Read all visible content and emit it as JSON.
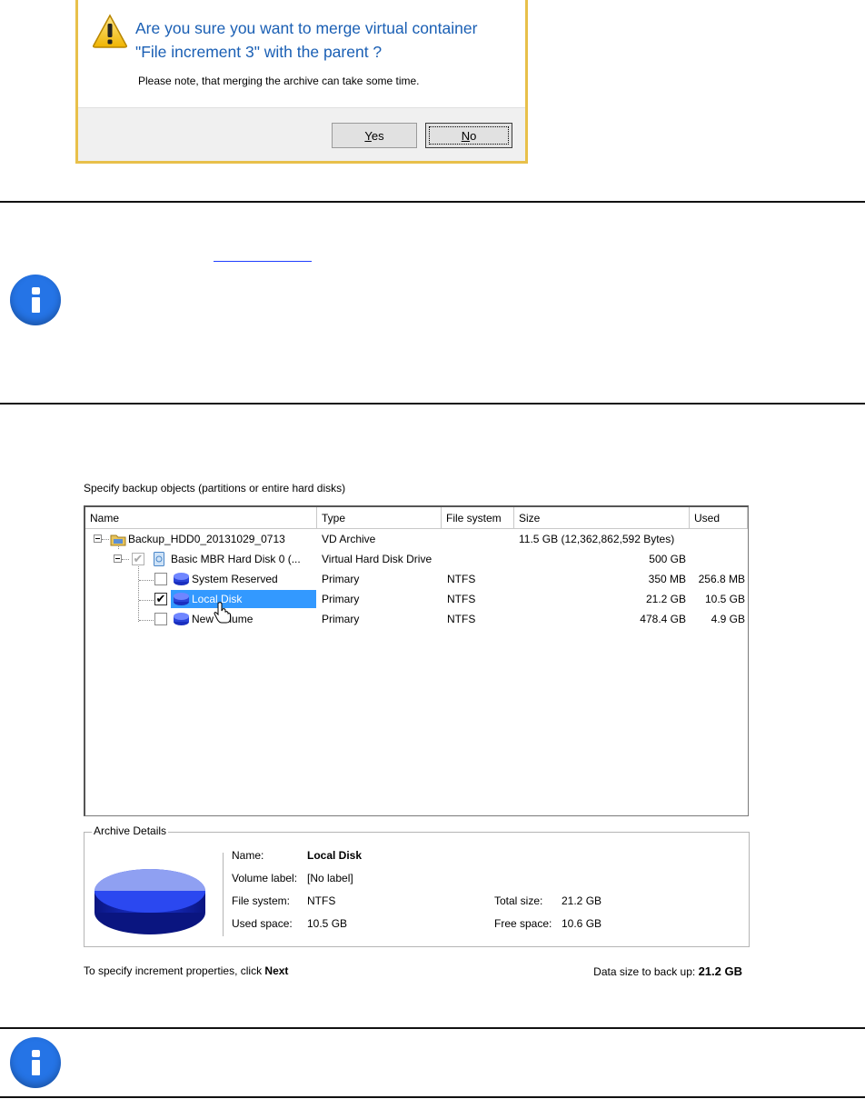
{
  "dialog": {
    "question_line1": "Are you sure you want to merge virtual container",
    "question_line2": "\"File increment 3\" with the parent ?",
    "note": "Please note, that merging the archive can take some time.",
    "yes_label": "Yes",
    "no_label": "No"
  },
  "wizard": {
    "caption": "Specify backup objects (partitions or entire hard disks)",
    "columns": [
      "Name",
      "Type",
      "File system",
      "Size",
      "Used"
    ],
    "rows": [
      {
        "name": "Backup_HDD0_20131029_0713",
        "type": "VD Archive",
        "fs": "",
        "size": "11.5 GB (12,362,862,592 Bytes)",
        "used": ""
      },
      {
        "name": "Basic MBR Hard Disk 0 (...",
        "type": "Virtual Hard Disk Drive",
        "fs": "",
        "size": "500 GB",
        "used": ""
      },
      {
        "name": "System Reserved",
        "type": "Primary",
        "fs": "NTFS",
        "size": "350 MB",
        "used": "256.8 MB",
        "checked": false
      },
      {
        "name": "Local Disk",
        "type": "Primary",
        "fs": "NTFS",
        "size": "21.2 GB",
        "used": "10.5 GB",
        "checked": true,
        "selected": true
      },
      {
        "name": "New Volume",
        "type": "Primary",
        "fs": "NTFS",
        "size": "478.4 GB",
        "used": "4.9 GB",
        "checked": false
      }
    ],
    "details": {
      "legend": "Archive Details",
      "name_label": "Name:",
      "name_value": "Local Disk",
      "volume_label_label": "Volume label:",
      "volume_label_value": "[No label]",
      "fs_label": "File system:",
      "fs_value": "NTFS",
      "used_label": "Used space:",
      "used_value": "10.5 GB",
      "total_label": "Total size:",
      "total_value": "21.2 GB",
      "free_label": "Free space:",
      "free_value": "10.6 GB"
    },
    "footer_prefix": "To specify increment properties, click ",
    "footer_next": "Next",
    "data_size_label": "Data size to back up: ",
    "data_size_value": "21.2 GB"
  },
  "colors": {
    "dialog_border": "#e8c04a",
    "question_text": "#1a5fb4",
    "info_icon": "#2574e6",
    "selection": "#3399ff"
  }
}
